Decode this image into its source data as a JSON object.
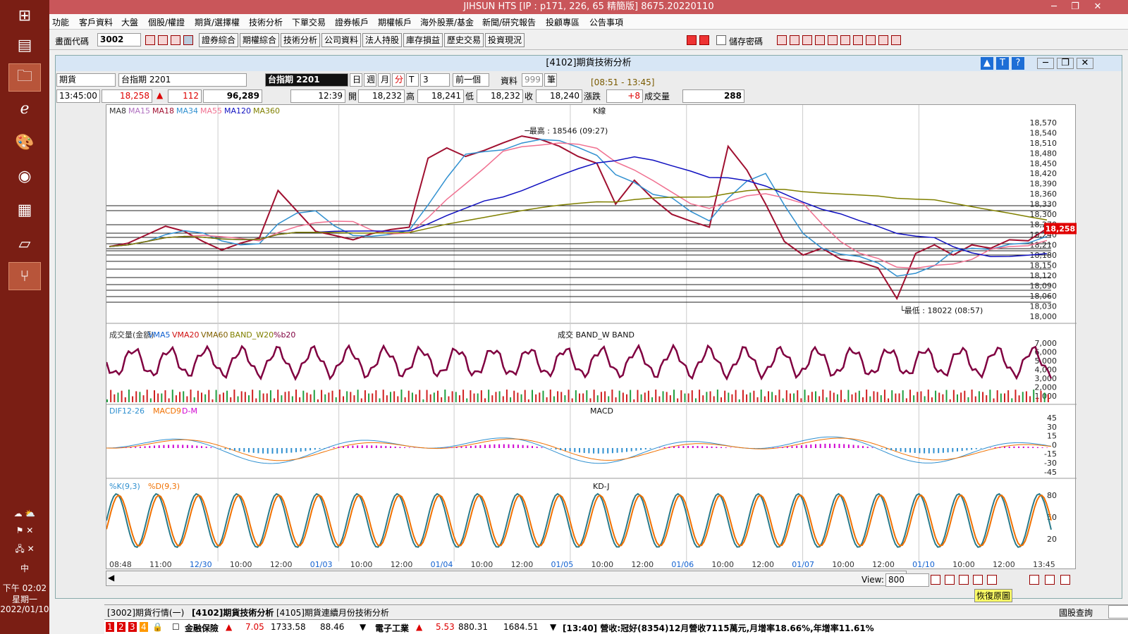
{
  "taskbar": {
    "time": "下午 02:02",
    "weekday": "星期一",
    "date": "2022/01/10",
    "ime": "中"
  },
  "app": {
    "title": "JIHSUN HTS     [IP : p171, 226, 65 精簡版] 8675.20220110"
  },
  "menu": [
    "功能",
    "客戶資料",
    "大盤",
    "個股/權證",
    "期貨/選擇權",
    "技術分析",
    "下單交易",
    "證券帳戶",
    "期權帳戶",
    "海外股票/基金",
    "新聞/研究報告",
    "投顧專區",
    "公告事項"
  ],
  "toolbar": {
    "code_label": "畫面代碼",
    "code_value": "3002",
    "buttons": [
      "證券綜合",
      "期權綜合",
      "技術分析",
      "公司資料",
      "法人持股",
      "庫存損益",
      "歷史交易",
      "投資現況"
    ],
    "remember": "儲存密碼"
  },
  "chart_window": {
    "title": "[4102]期貨技術分析",
    "type_select": "期貨",
    "instrument_select": "台指期 2201",
    "instrument_display": "台指期 2201",
    "periods": [
      "日",
      "週",
      "月",
      "分",
      "T"
    ],
    "interval": "3",
    "prev_btn": "前一個",
    "data_label": "資料",
    "data_count": "999",
    "bars_label": "筆",
    "session": "[08:51 - 13:45]",
    "quote": {
      "time": "13:45:00",
      "price": "18,258",
      "change": "112",
      "volume": "96,289",
      "last_time": "12:39",
      "open_lbl": "開",
      "open": "18,232",
      "high_lbl": "高",
      "high": "18,241",
      "low_lbl": "低",
      "low": "18,232",
      "close_lbl": "收",
      "close": "18,240",
      "chg_lbl": "漲跌",
      "chg": "+8",
      "vol_lbl": "成交量",
      "vol": "288"
    },
    "ma_legend": [
      {
        "t": "MA8",
        "c": "#333333"
      },
      {
        "t": "MA15",
        "c": "#b070c0"
      },
      {
        "t": "MA18",
        "c": "#a01030"
      },
      {
        "t": "MA34",
        "c": "#3090d0"
      },
      {
        "t": "MA55",
        "c": "#f07090"
      },
      {
        "t": "MA120",
        "c": "#1010c0"
      },
      {
        "t": "MA360",
        "c": "#808000"
      }
    ],
    "kline_label": "K線",
    "high_note": "最高 : 18546 (09:27)",
    "low_note": "最低 : 18022 (08:57)",
    "last_price_tag": "18,258",
    "vol_legend": [
      {
        "t": "成交量(金額)",
        "c": "#333333"
      },
      {
        "t": "VMA5",
        "c": "#1060d0"
      },
      {
        "t": "VMA20",
        "c": "#d01010"
      },
      {
        "t": "VMA60",
        "c": "#806000"
      },
      {
        "t": "BAND_W20",
        "c": "#808000"
      },
      {
        "t": "%b20",
        "c": "#800040"
      }
    ],
    "vol_panel_label": "成交   BAND_W   BAND",
    "macd_legend": [
      {
        "t": "DIF12-26",
        "c": "#3090d0"
      },
      {
        "t": "MACD9",
        "c": "#f07000"
      },
      {
        "t": "D-M",
        "c": "#d000d0"
      }
    ],
    "macd_label": "MACD",
    "kd_legend": [
      {
        "t": "%K(9,3)",
        "c": "#3090d0"
      },
      {
        "t": "%D(9,3)",
        "c": "#f07000"
      }
    ],
    "kd_label": "KD-J",
    "x_labels": [
      {
        "t": "08:48",
        "c": "#333"
      },
      {
        "t": "11:00",
        "c": "#333"
      },
      {
        "t": "12/30",
        "c": "#1060d0"
      },
      {
        "t": "10:00",
        "c": "#333"
      },
      {
        "t": "12:00",
        "c": "#333"
      },
      {
        "t": "01/03",
        "c": "#1060d0"
      },
      {
        "t": "10:00",
        "c": "#333"
      },
      {
        "t": "12:00",
        "c": "#333"
      },
      {
        "t": "01/04",
        "c": "#1060d0"
      },
      {
        "t": "10:00",
        "c": "#333"
      },
      {
        "t": "12:00",
        "c": "#333"
      },
      {
        "t": "01/05",
        "c": "#1060d0"
      },
      {
        "t": "10:00",
        "c": "#333"
      },
      {
        "t": "12:00",
        "c": "#333"
      },
      {
        "t": "01/06",
        "c": "#1060d0"
      },
      {
        "t": "10:00",
        "c": "#333"
      },
      {
        "t": "12:00",
        "c": "#333"
      },
      {
        "t": "01/07",
        "c": "#1060d0"
      },
      {
        "t": "10:00",
        "c": "#333"
      },
      {
        "t": "12:00",
        "c": "#333"
      },
      {
        "t": "01/10",
        "c": "#1060d0"
      },
      {
        "t": "10:00",
        "c": "#333"
      },
      {
        "t": "12:00",
        "c": "#333"
      },
      {
        "t": "13:45",
        "c": "#333"
      }
    ],
    "view_label": "View:",
    "view_value": "800",
    "restore_btn": "恢復原圖"
  },
  "chart_data": {
    "type": "line",
    "price_axis": [
      "18,570",
      "18,540",
      "18,510",
      "18,480",
      "18,450",
      "18,420",
      "18,390",
      "18,360",
      "18,330",
      "18,300",
      "18,270",
      "18,240",
      "18,210",
      "18,180",
      "18,150",
      "18,120",
      "18,090",
      "18,060",
      "18,030",
      "18,000"
    ],
    "price_ylim": [
      18000,
      18580
    ],
    "close_series": [
      18205,
      18215,
      18240,
      18265,
      18250,
      18220,
      18195,
      18215,
      18230,
      18370,
      18310,
      18250,
      18238,
      18225,
      18243,
      18255,
      18262,
      18465,
      18495,
      18470,
      18488,
      18510,
      18530,
      18520,
      18500,
      18470,
      18450,
      18330,
      18400,
      18345,
      18300,
      18280,
      18262,
      18500,
      18430,
      18330,
      18220,
      18180,
      18200,
      18168,
      18160,
      18142,
      18052,
      18185,
      18210,
      18180,
      18210,
      18200,
      18225,
      18222,
      18258
    ],
    "high_value": 18546,
    "low_value": 18022,
    "volume_axis": [
      "7,000",
      "6,000",
      "5,000",
      "4,000",
      "3,000",
      "2,000",
      "1,000"
    ],
    "macd_axis": [
      "45",
      "30",
      "15",
      "0",
      "-15",
      "-30",
      "-45"
    ],
    "kd_axis": [
      "80",
      "50",
      "20"
    ]
  },
  "bottom_tabs": [
    "[3002]期貨行情(一)",
    "[4102]期貨技術分析",
    "[4105]期貨連續月份技術分析"
  ],
  "bottom_right": "國股查詢",
  "ticker": {
    "nums": [
      "1",
      "2",
      "3",
      "4"
    ],
    "i1_name": "金融保險",
    "i1_chg": "7.05",
    "i1_val": "1733.58",
    "i1_extra": "88.46",
    "i2_name": "電子工業",
    "i2_chg": "5.53",
    "i2_val": "880.31",
    "i2_extra": "1684.51",
    "news": "[13:40] 營收:冠好(8354)12月營收7115萬元,月增率18.66%,年增率11.61%"
  }
}
